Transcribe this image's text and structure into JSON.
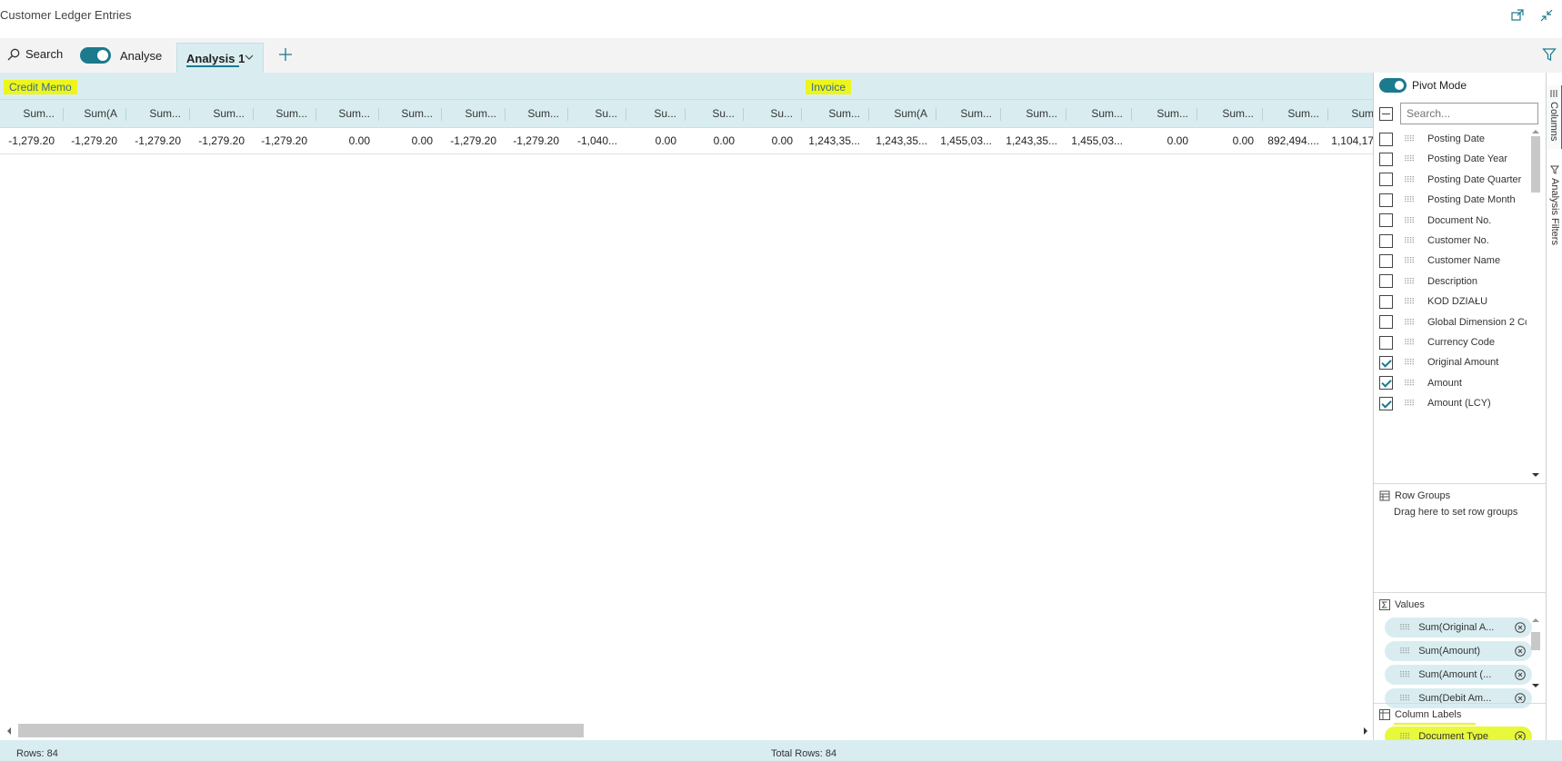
{
  "window": {
    "title": "Customer Ledger Entries"
  },
  "toolbar": {
    "search_label": "Search",
    "analyse_label": "Analyse",
    "analyse_on": true,
    "active_tab": "Analysis 1"
  },
  "grid": {
    "column_groups": [
      "Credit Memo",
      "Invoice"
    ],
    "headers": [
      "Sum...",
      "Sum(A",
      "Sum...",
      "Sum...",
      "Sum...",
      "Sum...",
      "Sum...",
      "Sum...",
      "Sum...",
      "Su...",
      "Su...",
      "Su...",
      "Su...",
      "Sum...",
      "Sum(A",
      "Sum...",
      "Sum...",
      "Sum...",
      "Sum...",
      "Sum...",
      "Sum...",
      "Sum"
    ],
    "row": [
      "-1,279.20",
      "-1,279.20",
      "-1,279.20",
      "-1,279.20",
      "-1,279.20",
      "0.00",
      "0.00",
      "-1,279.20",
      "-1,279.20",
      "-1,040...",
      "0.00",
      "0.00",
      "0.00",
      "1,243,35...",
      "1,243,35...",
      "1,455,03...",
      "1,243,35...",
      "1,455,03...",
      "0.00",
      "0.00",
      "892,494....",
      "1,104,17"
    ]
  },
  "status": {
    "rows": "Rows: 84",
    "total_rows": "Total Rows: 84"
  },
  "panel": {
    "pivot_mode_label": "Pivot Mode",
    "pivot_mode_on": true,
    "search_placeholder": "Search...",
    "columns": [
      {
        "label": "Posting Date",
        "checked": false
      },
      {
        "label": "Posting Date Year",
        "checked": false
      },
      {
        "label": "Posting Date Quarter",
        "checked": false
      },
      {
        "label": "Posting Date Month",
        "checked": false
      },
      {
        "label": "Document No.",
        "checked": false
      },
      {
        "label": "Customer No.",
        "checked": false
      },
      {
        "label": "Customer Name",
        "checked": false
      },
      {
        "label": "Description",
        "checked": false
      },
      {
        "label": "KOD DZIAŁU",
        "checked": false
      },
      {
        "label": "Global Dimension 2 Co",
        "checked": false
      },
      {
        "label": "Currency Code",
        "checked": false
      },
      {
        "label": "Original Amount",
        "checked": true
      },
      {
        "label": "Amount",
        "checked": true
      },
      {
        "label": "Amount (LCY)",
        "checked": true
      }
    ],
    "row_groups": {
      "title": "Row Groups",
      "hint": "Drag here to set row groups"
    },
    "values": {
      "title": "Values",
      "items": [
        "Sum(Original A...",
        "Sum(Amount)",
        "Sum(Amount (...",
        "Sum(Debit Am..."
      ]
    },
    "column_labels": {
      "title": "Column Labels",
      "items": [
        "Document Type"
      ]
    }
  },
  "side_tabs": [
    "Columns",
    "Analysis Filters"
  ],
  "colors": {
    "accent": "#1b7a8c",
    "header_bg": "#d9edf1",
    "highlight": "#eef51b"
  }
}
